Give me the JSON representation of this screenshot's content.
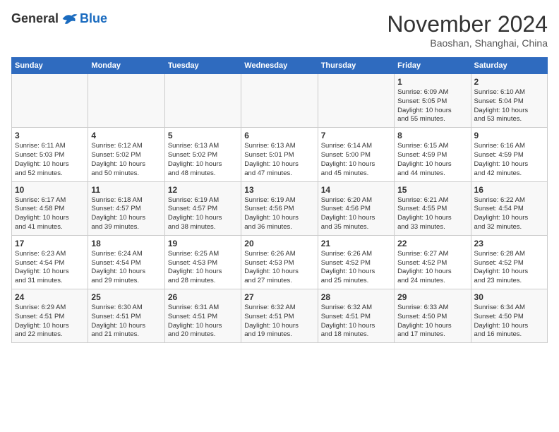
{
  "header": {
    "logo_general": "General",
    "logo_blue": "Blue",
    "title": "November 2024",
    "location": "Baoshan, Shanghai, China"
  },
  "calendar": {
    "days_of_week": [
      "Sunday",
      "Monday",
      "Tuesday",
      "Wednesday",
      "Thursday",
      "Friday",
      "Saturday"
    ],
    "weeks": [
      [
        {
          "day": "",
          "info": ""
        },
        {
          "day": "",
          "info": ""
        },
        {
          "day": "",
          "info": ""
        },
        {
          "day": "",
          "info": ""
        },
        {
          "day": "",
          "info": ""
        },
        {
          "day": "1",
          "info": "Sunrise: 6:09 AM\nSunset: 5:05 PM\nDaylight: 10 hours\nand 55 minutes."
        },
        {
          "day": "2",
          "info": "Sunrise: 6:10 AM\nSunset: 5:04 PM\nDaylight: 10 hours\nand 53 minutes."
        }
      ],
      [
        {
          "day": "3",
          "info": "Sunrise: 6:11 AM\nSunset: 5:03 PM\nDaylight: 10 hours\nand 52 minutes."
        },
        {
          "day": "4",
          "info": "Sunrise: 6:12 AM\nSunset: 5:02 PM\nDaylight: 10 hours\nand 50 minutes."
        },
        {
          "day": "5",
          "info": "Sunrise: 6:13 AM\nSunset: 5:02 PM\nDaylight: 10 hours\nand 48 minutes."
        },
        {
          "day": "6",
          "info": "Sunrise: 6:13 AM\nSunset: 5:01 PM\nDaylight: 10 hours\nand 47 minutes."
        },
        {
          "day": "7",
          "info": "Sunrise: 6:14 AM\nSunset: 5:00 PM\nDaylight: 10 hours\nand 45 minutes."
        },
        {
          "day": "8",
          "info": "Sunrise: 6:15 AM\nSunset: 4:59 PM\nDaylight: 10 hours\nand 44 minutes."
        },
        {
          "day": "9",
          "info": "Sunrise: 6:16 AM\nSunset: 4:59 PM\nDaylight: 10 hours\nand 42 minutes."
        }
      ],
      [
        {
          "day": "10",
          "info": "Sunrise: 6:17 AM\nSunset: 4:58 PM\nDaylight: 10 hours\nand 41 minutes."
        },
        {
          "day": "11",
          "info": "Sunrise: 6:18 AM\nSunset: 4:57 PM\nDaylight: 10 hours\nand 39 minutes."
        },
        {
          "day": "12",
          "info": "Sunrise: 6:19 AM\nSunset: 4:57 PM\nDaylight: 10 hours\nand 38 minutes."
        },
        {
          "day": "13",
          "info": "Sunrise: 6:19 AM\nSunset: 4:56 PM\nDaylight: 10 hours\nand 36 minutes."
        },
        {
          "day": "14",
          "info": "Sunrise: 6:20 AM\nSunset: 4:56 PM\nDaylight: 10 hours\nand 35 minutes."
        },
        {
          "day": "15",
          "info": "Sunrise: 6:21 AM\nSunset: 4:55 PM\nDaylight: 10 hours\nand 33 minutes."
        },
        {
          "day": "16",
          "info": "Sunrise: 6:22 AM\nSunset: 4:54 PM\nDaylight: 10 hours\nand 32 minutes."
        }
      ],
      [
        {
          "day": "17",
          "info": "Sunrise: 6:23 AM\nSunset: 4:54 PM\nDaylight: 10 hours\nand 31 minutes."
        },
        {
          "day": "18",
          "info": "Sunrise: 6:24 AM\nSunset: 4:54 PM\nDaylight: 10 hours\nand 29 minutes."
        },
        {
          "day": "19",
          "info": "Sunrise: 6:25 AM\nSunset: 4:53 PM\nDaylight: 10 hours\nand 28 minutes."
        },
        {
          "day": "20",
          "info": "Sunrise: 6:26 AM\nSunset: 4:53 PM\nDaylight: 10 hours\nand 27 minutes."
        },
        {
          "day": "21",
          "info": "Sunrise: 6:26 AM\nSunset: 4:52 PM\nDaylight: 10 hours\nand 25 minutes."
        },
        {
          "day": "22",
          "info": "Sunrise: 6:27 AM\nSunset: 4:52 PM\nDaylight: 10 hours\nand 24 minutes."
        },
        {
          "day": "23",
          "info": "Sunrise: 6:28 AM\nSunset: 4:52 PM\nDaylight: 10 hours\nand 23 minutes."
        }
      ],
      [
        {
          "day": "24",
          "info": "Sunrise: 6:29 AM\nSunset: 4:51 PM\nDaylight: 10 hours\nand 22 minutes."
        },
        {
          "day": "25",
          "info": "Sunrise: 6:30 AM\nSunset: 4:51 PM\nDaylight: 10 hours\nand 21 minutes."
        },
        {
          "day": "26",
          "info": "Sunrise: 6:31 AM\nSunset: 4:51 PM\nDaylight: 10 hours\nand 20 minutes."
        },
        {
          "day": "27",
          "info": "Sunrise: 6:32 AM\nSunset: 4:51 PM\nDaylight: 10 hours\nand 19 minutes."
        },
        {
          "day": "28",
          "info": "Sunrise: 6:32 AM\nSunset: 4:51 PM\nDaylight: 10 hours\nand 18 minutes."
        },
        {
          "day": "29",
          "info": "Sunrise: 6:33 AM\nSunset: 4:50 PM\nDaylight: 10 hours\nand 17 minutes."
        },
        {
          "day": "30",
          "info": "Sunrise: 6:34 AM\nSunset: 4:50 PM\nDaylight: 10 hours\nand 16 minutes."
        }
      ]
    ]
  }
}
